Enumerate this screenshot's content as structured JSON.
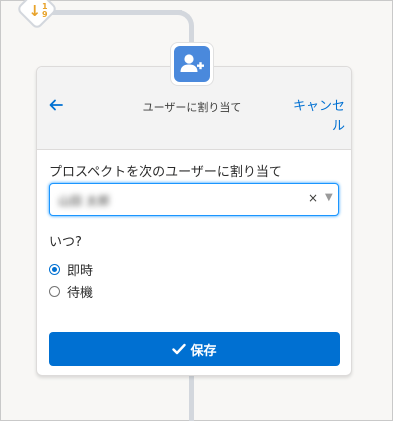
{
  "sort_node": {
    "icon": "sort-descending-icon",
    "digit_top": "1",
    "digit_bottom": "9"
  },
  "card": {
    "header_title": "ユーザーに割り当て",
    "back_icon": "back-arrow-icon",
    "cancel_label": "キャンセル",
    "badge_icon": "add-user-icon"
  },
  "assign": {
    "label": "プロスペクトを次のユーザーに割り当て",
    "selected_value": "山田 太郎",
    "clear_symbol": "×",
    "caret_symbol": "▼"
  },
  "when": {
    "label": "いつ?",
    "options": [
      {
        "label": "即時",
        "checked": true
      },
      {
        "label": "待機",
        "checked": false
      }
    ]
  },
  "save": {
    "label": "保存",
    "icon": "checkmark-icon"
  },
  "colors": {
    "accent": "#0070d2",
    "badge": "#4a89dc",
    "sort_icon": "#e8a32b",
    "connector": "#d3d7dd"
  }
}
